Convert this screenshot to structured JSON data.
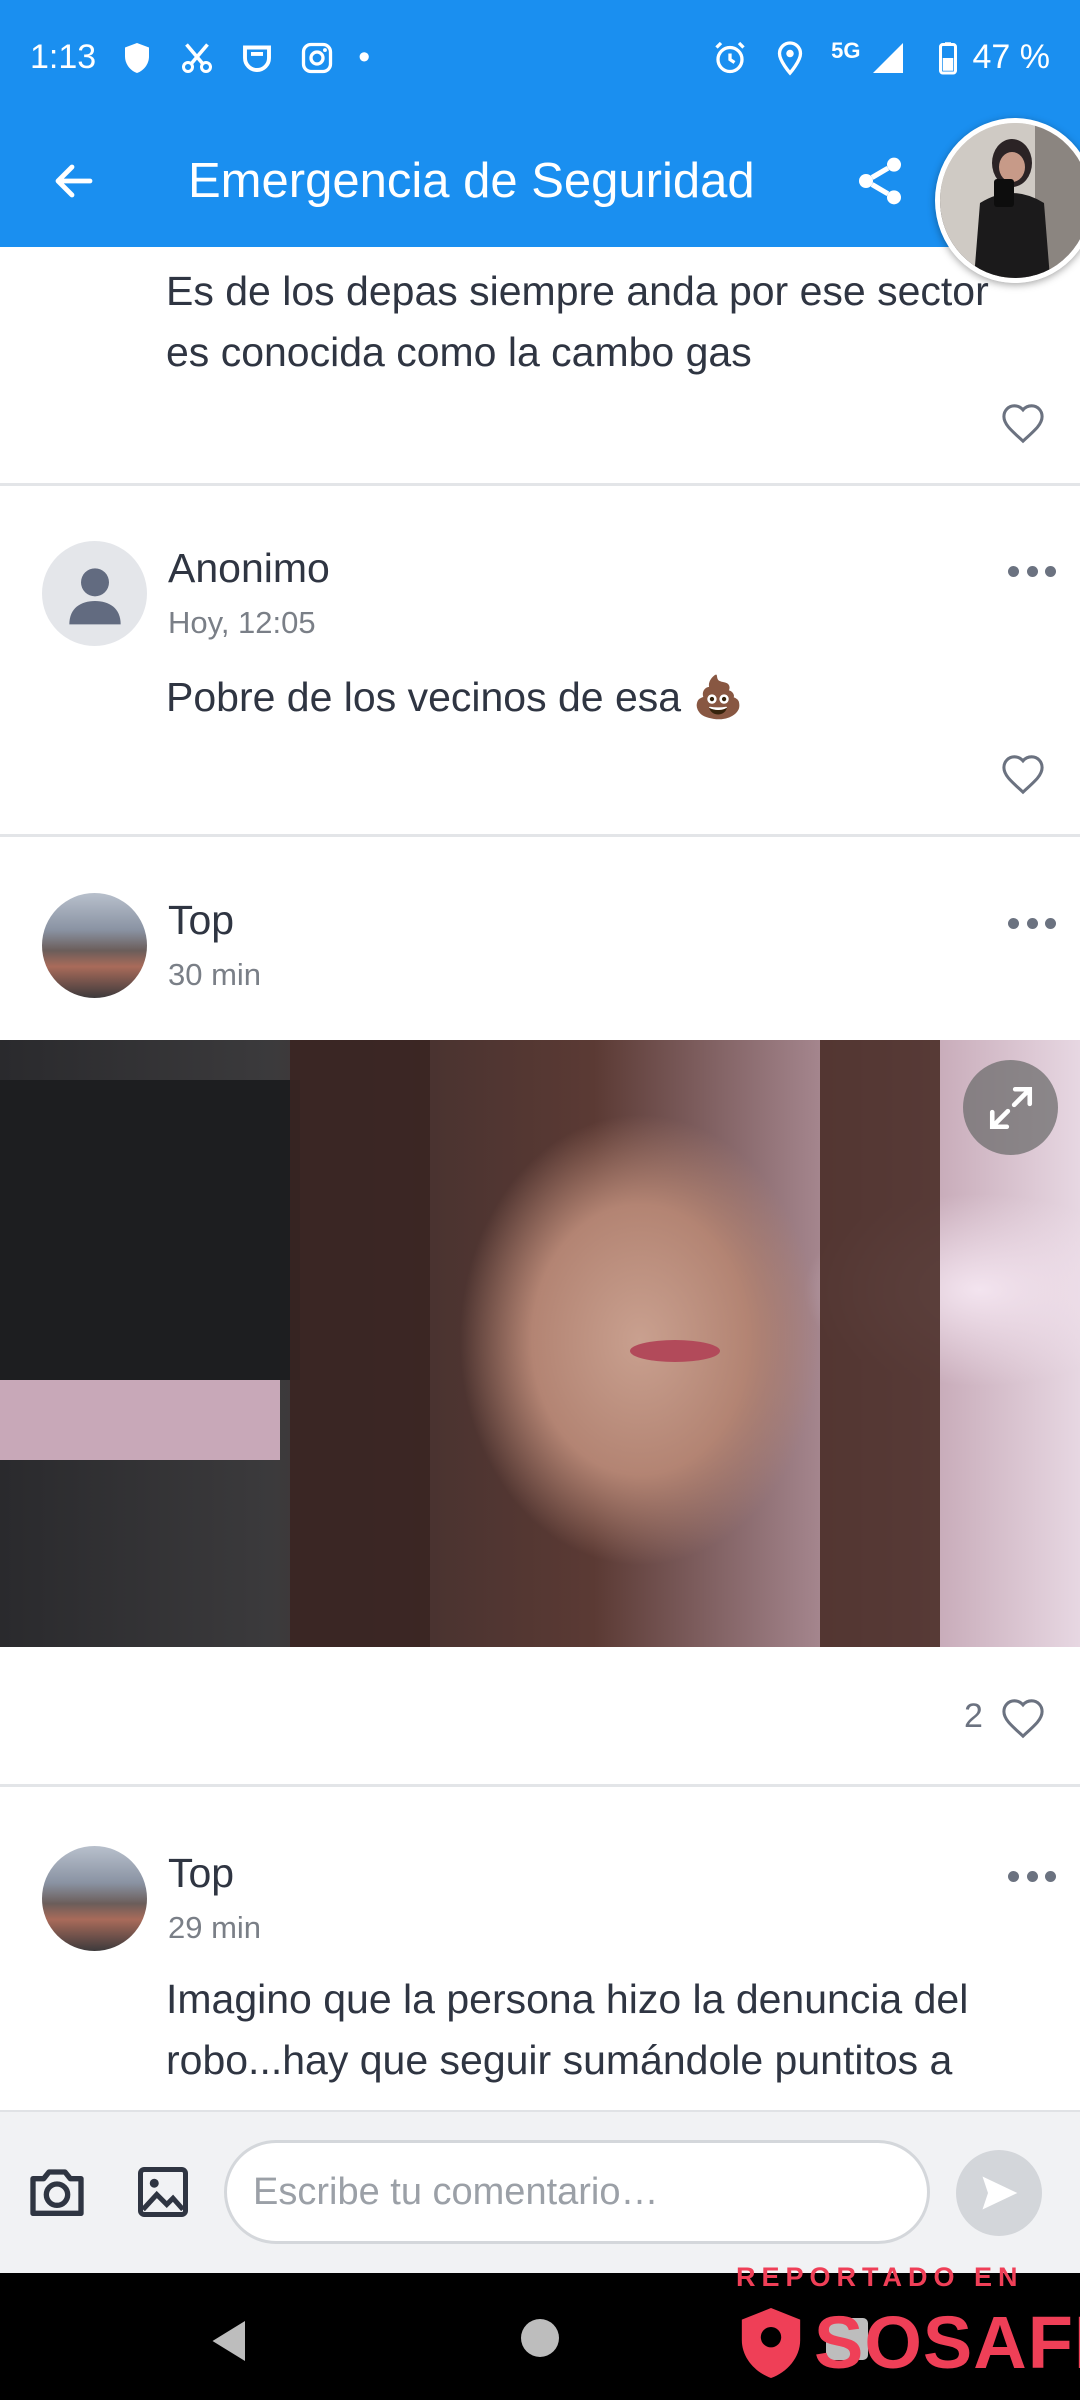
{
  "status_bar": {
    "time": "1:13",
    "network": "5G",
    "battery": "47 %",
    "left_icons": [
      "shield-icon",
      "scissors-icon",
      "badge-icon",
      "instagram-icon"
    ],
    "dot": "•",
    "right_icons": [
      "alarm-icon",
      "location-icon",
      "signal-icon",
      "battery-icon"
    ]
  },
  "app_bar": {
    "title": "Emergencia de Seguridad",
    "back_icon": "arrow-left-icon",
    "share_icon": "share-icon"
  },
  "feed": {
    "partial_comment": {
      "text": "Es de los depas siempre anda por ese sector es conocida como la cambo gas"
    },
    "comments": [
      {
        "user": "Anonimo",
        "time": "Hoy, 12:05",
        "text": "Pobre de los vecinos de esa 💩"
      },
      {
        "user": "Top",
        "time": "30 min",
        "likes": "2",
        "has_image": true
      },
      {
        "user": "Top",
        "time": "29 min",
        "text": "Imagino que la persona hizo la denuncia del robo...hay que seguir sumándole puntitos a"
      }
    ]
  },
  "input_bar": {
    "placeholder": "Escribe tu comentario…",
    "camera_icon": "camera-icon",
    "gallery_icon": "image-icon",
    "send_icon": "send-icon"
  },
  "watermark": {
    "reported": "REPORTADO EN",
    "brand": "SOSAFE"
  },
  "colors": {
    "primary": "#1a8ff0",
    "text": "#2f3542",
    "muted": "#7a7f87",
    "brand_red": "#ef3f57"
  }
}
